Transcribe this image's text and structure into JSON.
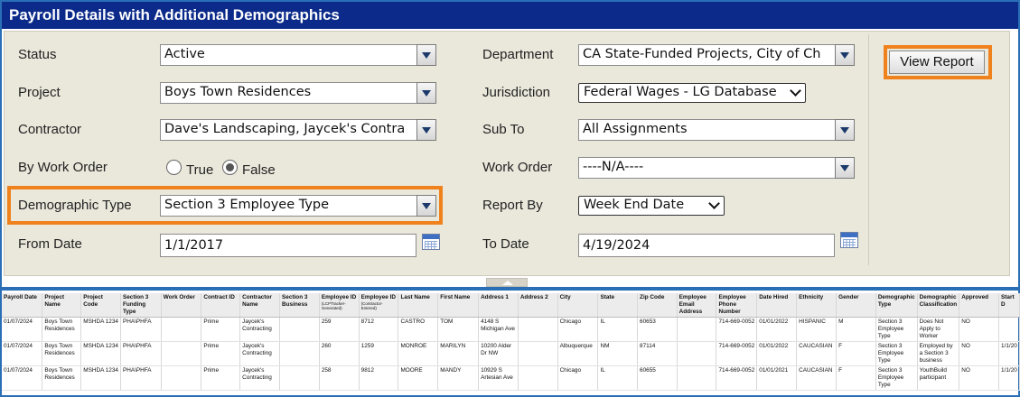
{
  "title": "Payroll Details with Additional Demographics",
  "form": {
    "status": {
      "label": "Status",
      "value": "Active"
    },
    "project": {
      "label": "Project",
      "value": "Boys Town Residences"
    },
    "contractor": {
      "label": "Contractor",
      "value": "Dave's Landscaping, Jaycek's Contra"
    },
    "by_work_order": {
      "label": "By Work Order",
      "opt_true": "True",
      "opt_false": "False",
      "selected": "False"
    },
    "demographic_type": {
      "label": "Demographic Type",
      "value": "Section 3 Employee Type"
    },
    "from_date": {
      "label": "From Date",
      "value": "1/1/2017"
    },
    "department": {
      "label": "Department",
      "value": "CA State-Funded Projects, City of Ch"
    },
    "jurisdiction": {
      "label": "Jurisdiction",
      "value": "Federal Wages - LG Database"
    },
    "sub_to": {
      "label": "Sub To",
      "value": "All Assignments"
    },
    "work_order": {
      "label": "Work Order",
      "value": "----N/A----"
    },
    "report_by": {
      "label": "Report By",
      "value": "Week End Date"
    },
    "to_date": {
      "label": "To Date",
      "value": "4/19/2024"
    }
  },
  "view_report_label": "View Report",
  "highlight_color": "#f0821e",
  "table": {
    "columns": [
      {
        "label": "Payroll Date"
      },
      {
        "label": "Project Name"
      },
      {
        "label": "Project Code"
      },
      {
        "label": "Section 3 Funding Type"
      },
      {
        "label": "Work Order"
      },
      {
        "label": "Contract ID"
      },
      {
        "label": "Contractor Name"
      },
      {
        "label": "Section 3 Business"
      },
      {
        "label": "Employee ID",
        "sub": "(LCPTracker-Generated)"
      },
      {
        "label": "Employee ID",
        "sub": "(Contractor-Entered)"
      },
      {
        "label": "Last Name"
      },
      {
        "label": "First Name"
      },
      {
        "label": "Address 1"
      },
      {
        "label": "Address 2"
      },
      {
        "label": "City"
      },
      {
        "label": "State"
      },
      {
        "label": "Zip Code"
      },
      {
        "label": "Employee Email Address"
      },
      {
        "label": "Employee Phone Number"
      },
      {
        "label": "Date Hired"
      },
      {
        "label": "Ethnicity"
      },
      {
        "label": "Gender"
      },
      {
        "label": "Demographic Type"
      },
      {
        "label": "Demographic Classification"
      },
      {
        "label": "Approved"
      },
      {
        "label": "Start D"
      }
    ],
    "rows": [
      [
        "01/07/2024",
        "Boys Town Residences",
        "MSHDA 1234",
        "PHA\\PHFA",
        "",
        "Prime",
        "Jaycek's Contracting",
        "",
        "259",
        "8712",
        "CASTRO",
        "TOM",
        "4148 S Michigan Ave",
        "",
        "Chicago",
        "IL",
        "60653",
        "",
        "714-669-0052",
        "01/01/2022",
        "HISPANIC",
        "M",
        "Section 3 Employee Type",
        "Does Not Apply to Worker",
        "NO",
        ""
      ],
      [
        "01/07/2024",
        "Boys Town Residences",
        "MSHDA 1234",
        "PHA\\PHFA",
        "",
        "Prime",
        "Jaycek's Contracting",
        "",
        "260",
        "1259",
        "MONROE",
        "MARILYN",
        "10200 Alder Dr NW",
        "",
        "Albuquerque",
        "NM",
        "87114",
        "",
        "714-669-0052",
        "01/01/2022",
        "CAUCASIAN",
        "F",
        "Section 3 Employee Type",
        "Employed by a Section 3 business",
        "NO",
        "1/1/20"
      ],
      [
        "01/07/2024",
        "Boys Town Residences",
        "MSHDA 1234",
        "PHA\\PHFA",
        "",
        "Prime",
        "Jaycek's Contracting",
        "",
        "258",
        "9812",
        "MOORE",
        "MANDY",
        "10929 S Artesian Ave",
        "",
        "Chicago",
        "IL",
        "60655",
        "",
        "714-669-0052",
        "01/01/2021",
        "CAUCASIAN",
        "F",
        "Section 3 Employee Type",
        "YouthBuild participant",
        "NO",
        "1/1/20"
      ]
    ]
  }
}
